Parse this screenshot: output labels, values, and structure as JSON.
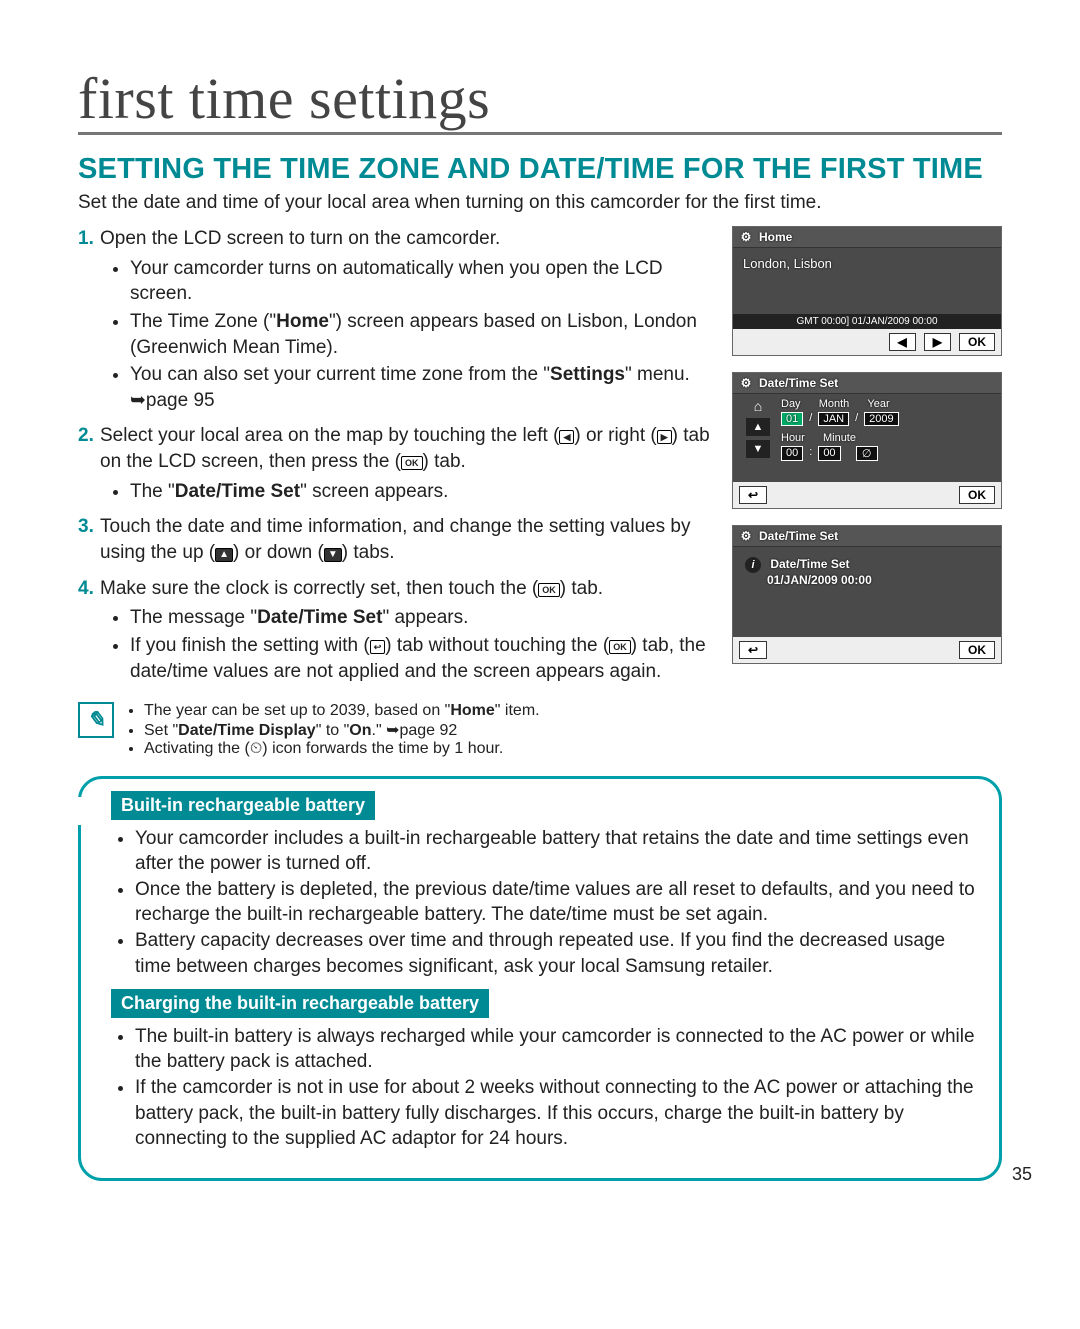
{
  "title": "first time settings",
  "section_title": "SETTING THE TIME ZONE AND DATE/TIME FOR THE FIRST TIME",
  "intro": "Set the date and time of your local area when turning on this camcorder for the first time.",
  "steps": [
    {
      "num": "1.",
      "text": "Open the LCD screen to turn on the camcorder.",
      "subs": [
        "Your camcorder turns on automatically when you open the LCD screen.",
        "The Time Zone (\"<b>Home</b>\") screen appears based on Lisbon, London (Greenwich Mean Time).",
        "You can also set your current time zone from the \"<b>Settings</b>\" menu. ➥page 95"
      ]
    },
    {
      "num": "2.",
      "text": "Select your local area on the map by touching the left (<span class='inline-btn light'>◀</span>) or right (<span class='inline-btn light'>▶</span>) tab on the LCD screen, then press the (<span class='inline-ok'>OK</span>) tab.",
      "subs": [
        "The \"<b>Date/Time Set</b>\" screen appears."
      ]
    },
    {
      "num": "3.",
      "text": "Touch the date and time information, and change the setting values by using the up (<span class='inline-btn dark'>▲</span>) or down (<span class='inline-btn dark'>▼</span>) tabs.",
      "subs": []
    },
    {
      "num": "4.",
      "text": "Make sure the clock is correctly set, then touch the (<span class='inline-ok'>OK</span>) tab.",
      "subs": [
        "The message \"<b>Date/Time Set</b>\" appears.",
        "If you finish the setting with (<span class='inline-btn light'>↩</span>) tab without touching the (<span class='inline-ok'>OK</span>) tab, the date/time values are not applied and the <Time zone> screen appears again."
      ]
    }
  ],
  "notes": [
    "The year can be set up to 2039, based on \"<b>Home</b>\" item.",
    "Set \"<b>Date/Time Display</b>\" to \"<b>On</b>.\" ➥page 92",
    "Activating the (⏲) icon forwards the time by 1 hour."
  ],
  "box1_title": "Built-in rechargeable battery",
  "box1_items": [
    "Your camcorder includes a built-in rechargeable battery that retains the date and time settings even after the power is turned off.",
    "Once the battery is depleted, the previous date/time values are all reset to defaults, and you need to recharge the built-in rechargeable battery. The date/time must be set again.",
    "Battery capacity decreases over time and through repeated use. If you find the decreased usage time between charges becomes significant, ask your local Samsung retailer."
  ],
  "box2_title": "Charging the built-in rechargeable battery",
  "box2_items": [
    "The built-in battery is always recharged while your camcorder is connected to the AC power or while the battery pack is attached.",
    "If the camcorder is not in use for about 2 weeks without connecting to the AC power or attaching the battery pack, the built-in battery fully discharges. If this occurs, charge the built-in battery by connecting to the supplied AC adaptor for 24 hours."
  ],
  "pagenum": "35",
  "lcd1": {
    "title": "Home",
    "city": "London, Lisbon",
    "status": "GMT 00:00] 01/JAN/2009 00:00",
    "left": "◀",
    "right": "▶",
    "ok": "OK"
  },
  "lcd2": {
    "title": "Date/Time Set",
    "labels": {
      "day": "Day",
      "month": "Month",
      "year": "Year",
      "hour": "Hour",
      "minute": "Minute"
    },
    "values": {
      "day": "01",
      "month": "JAN",
      "year": "2009",
      "hour": "00",
      "minute": "00"
    },
    "back": "↩",
    "ok": "OK",
    "up": "▲",
    "down": "▼"
  },
  "lcd3": {
    "title": "Date/Time Set",
    "msg1": "Date/Time Set",
    "msg2": "01/JAN/2009 00:00",
    "back": "↩",
    "ok": "OK"
  }
}
